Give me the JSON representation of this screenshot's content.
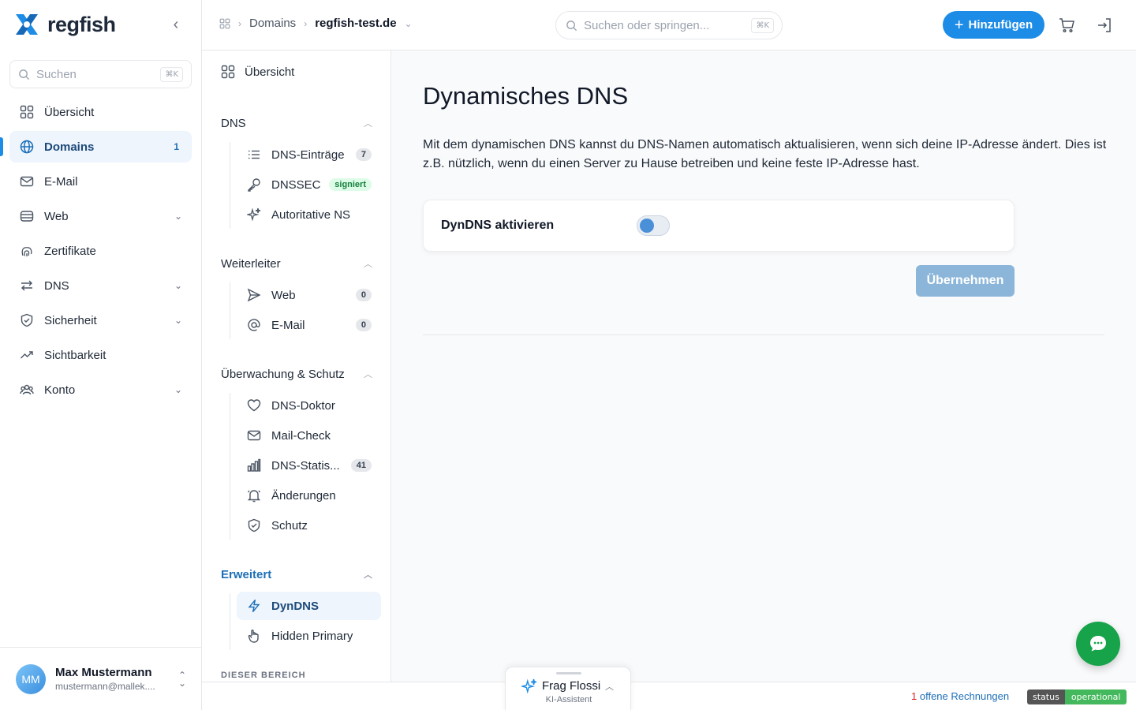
{
  "brand": {
    "name": "regfish"
  },
  "sidebar": {
    "search_placeholder": "Suchen",
    "search_shortcut": "⌘K",
    "items": [
      {
        "label": "Übersicht",
        "icon": "grid-icon"
      },
      {
        "label": "Domains",
        "icon": "globe-icon",
        "count": "1",
        "active": true
      },
      {
        "label": "E-Mail",
        "icon": "mail-icon"
      },
      {
        "label": "Web",
        "icon": "server-icon",
        "expandable": true
      },
      {
        "label": "Zertifikate",
        "icon": "fingerprint-icon"
      },
      {
        "label": "DNS",
        "icon": "arrows-icon",
        "expandable": true
      },
      {
        "label": "Sicherheit",
        "icon": "shield-icon",
        "expandable": true
      },
      {
        "label": "Sichtbarkeit",
        "icon": "trend-icon"
      },
      {
        "label": "Konto",
        "icon": "users-icon",
        "expandable": true
      }
    ],
    "user": {
      "initials": "MM",
      "name": "Max Mustermann",
      "email": "mustermann@mallek...."
    }
  },
  "topbar": {
    "breadcrumb": [
      "Domains",
      "regfish-test.de"
    ],
    "search_placeholder": "Suchen oder springen...",
    "search_shortcut": "⌘K",
    "add_label": "Hinzufügen"
  },
  "subnav": {
    "overview": "Übersicht",
    "groups": [
      {
        "title": "DNS",
        "items": [
          {
            "label": "DNS-Einträge",
            "icon": "list-icon",
            "badge": "7"
          },
          {
            "label": "DNSSEC",
            "icon": "key-icon",
            "badge": "signiert"
          },
          {
            "label": "Autoritative NS",
            "icon": "sparkles-icon"
          }
        ]
      },
      {
        "title": "Weiterleiter",
        "items": [
          {
            "label": "Web",
            "icon": "send-icon",
            "badge": "0"
          },
          {
            "label": "E-Mail",
            "icon": "at-icon",
            "badge": "0"
          }
        ]
      },
      {
        "title": "Überwachung & Schutz",
        "items": [
          {
            "label": "DNS-Doktor",
            "icon": "heart-icon"
          },
          {
            "label": "Mail-Check",
            "icon": "mail-icon"
          },
          {
            "label": "DNS-Statis...",
            "icon": "chart-icon",
            "badge": "41"
          },
          {
            "label": "Änderungen",
            "icon": "bell-icon"
          },
          {
            "label": "Schutz",
            "icon": "shield-icon"
          }
        ]
      },
      {
        "title": "Erweitert",
        "items": [
          {
            "label": "DynDNS",
            "icon": "bolt-icon",
            "active": true
          },
          {
            "label": "Hidden Primary",
            "icon": "hand-icon"
          }
        ]
      }
    ],
    "section_caption": "DIESER BEREICH"
  },
  "main": {
    "title": "Dynamisches DNS",
    "description": "Mit dem dynamischen DNS kannst du DNS-Namen automatisch aktualisieren, wenn sich deine IP-Adresse ändert. Dies ist z.B. nützlich, wenn du einen Server zu Hause betreiben und keine feste IP-Adresse hast.",
    "toggle_label": "DynDNS aktivieren",
    "toggle_on": false,
    "apply_label": "Übernehmen"
  },
  "footer": {
    "invoice_count": "1",
    "invoice_text": "offene Rechnungen",
    "status_label": "status",
    "status_value": "operational"
  },
  "assistant": {
    "title": "Frag Flossi",
    "subtitle": "KI-Assistent"
  },
  "colors": {
    "accent": "#1c8ce6",
    "chat": "#16a34a",
    "status_ok": "#44b85c"
  }
}
